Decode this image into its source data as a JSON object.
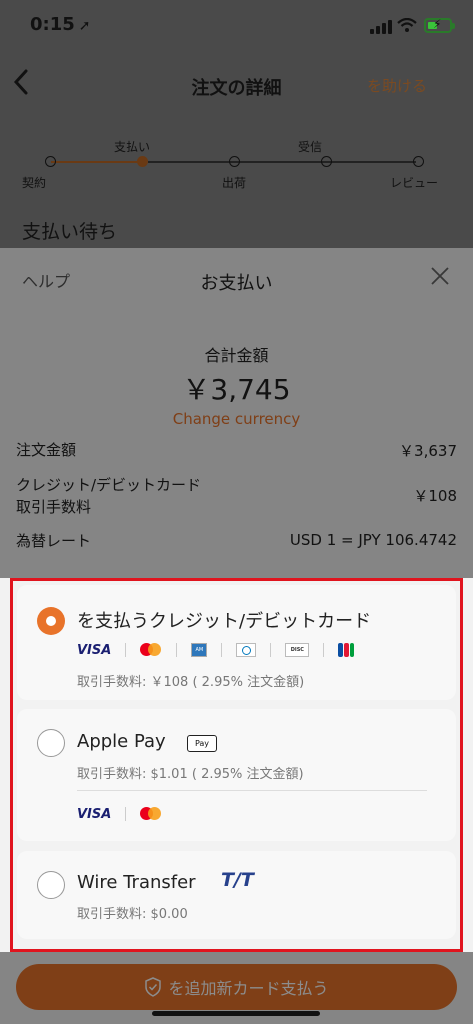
{
  "status_bar": {
    "time": "0:15"
  },
  "under_page": {
    "title": "注文の詳細",
    "help": "を助ける",
    "steps": [
      {
        "label": "契約",
        "position": "below",
        "state": "done"
      },
      {
        "label": "支払い",
        "position": "above",
        "state": "current"
      },
      {
        "label": "出荷",
        "position": "below",
        "state": "pending"
      },
      {
        "label": "受信",
        "position": "above",
        "state": "pending"
      },
      {
        "label": "レビュー",
        "position": "below",
        "state": "pending"
      }
    ],
    "status_heading": "支払い待ち"
  },
  "sheet": {
    "help": "ヘルプ",
    "title": "お支払い",
    "total_label": "合計金額",
    "total_amount": "￥3,745",
    "change_currency": "Change currency",
    "rows": [
      {
        "label": "注文金額",
        "value": "￥3,637"
      },
      {
        "label": "クレジット/デビットカード\n取引手数料",
        "value": "￥108"
      },
      {
        "label": "為替レート",
        "value": "USD 1 = JPY 106.4742"
      }
    ],
    "options": {
      "card": {
        "title": "を支払うクレジット/デビットカード",
        "fee": "取引手数料: ￥108 ( 2.95% 注文金額)",
        "selected": true,
        "logos": [
          "visa",
          "mastercard",
          "amex",
          "diners",
          "discover",
          "jcb"
        ]
      },
      "apple_pay": {
        "title": "Apple Pay",
        "badge": "Pay",
        "fee": "取引手数料: $1.01 ( 2.95% 注文金額)",
        "selected": false,
        "logos": [
          "visa",
          "mastercard"
        ]
      },
      "wire": {
        "title": "Wire Transfer",
        "logo_text": "T/T",
        "fee": "取引手数料: $0.00",
        "selected": false
      }
    },
    "bottom_button": "を追加新カード支払う"
  },
  "colors": {
    "accent": "#e8732a",
    "highlight_border": "#e0141e",
    "visa": "#1a1f71",
    "tt": "#27418c"
  }
}
